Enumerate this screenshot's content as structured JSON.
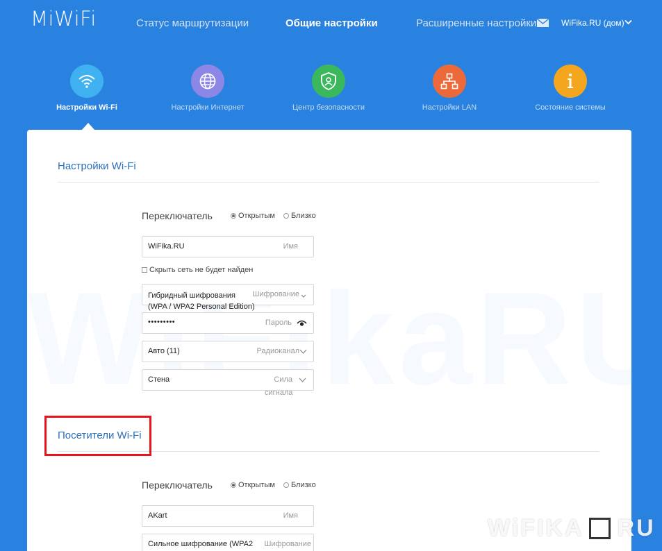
{
  "app": {
    "logo": "MiWiFi"
  },
  "topnav": {
    "items": [
      "Статус маршрутизации",
      "Общие настройки",
      "Расширенные настройки"
    ],
    "account": "WiFika.RU (дом)"
  },
  "iconbar": {
    "items": [
      {
        "label": "Настройки Wi-Fi",
        "icon": "wifi-icon",
        "color": "#3fb1f0"
      },
      {
        "label": "Настройки Интернет",
        "icon": "globe-icon",
        "color": "#8c86e6"
      },
      {
        "label": "Центр безопасности",
        "icon": "shield-icon",
        "color": "#3bb85b"
      },
      {
        "label": "Настройки LAN",
        "icon": "lan-icon",
        "color": "#ec6a39"
      },
      {
        "label": "Состояние системы",
        "icon": "info-icon",
        "color": "#f4a61e"
      }
    ]
  },
  "colors": {
    "background": "#2a82e0",
    "title": "#2c6fbb",
    "highlight": "#e8141b"
  },
  "wifi": {
    "title": "Настройки Wi-Fi",
    "switch_label": "Переключатель",
    "opt_open": "Открытым",
    "opt_close": "Близко",
    "name_value": "WiFika.RU",
    "name_tag": "Имя",
    "hide_label": "Скрыть сеть не будет найден",
    "enc_value_1": "Гибридный шифрования",
    "enc_value_2": "(WPA / WPA2 Personal Edition)",
    "enc_tag": "Шифрование",
    "pwd_value": "•••••••••",
    "pwd_tag": "Пароль",
    "channel_value": "Авто (11)",
    "channel_tag": "Радиоканал",
    "power_value": "Стена",
    "power_tag_1": "Сила",
    "power_tag_2": "сигнала"
  },
  "guest": {
    "title": "Посетители Wi-Fi",
    "switch_label": "Переключатель",
    "opt_open": "Открытым",
    "opt_close": "Близко",
    "name_value": "AKart",
    "name_tag": "Имя",
    "enc_value": "Сильное шифрование (WPA2",
    "enc_tag": "Шифрование"
  },
  "watermark": {
    "big": "WiFikaRU",
    "brand": "WiFIKA",
    "brand_suffix": "RU"
  }
}
